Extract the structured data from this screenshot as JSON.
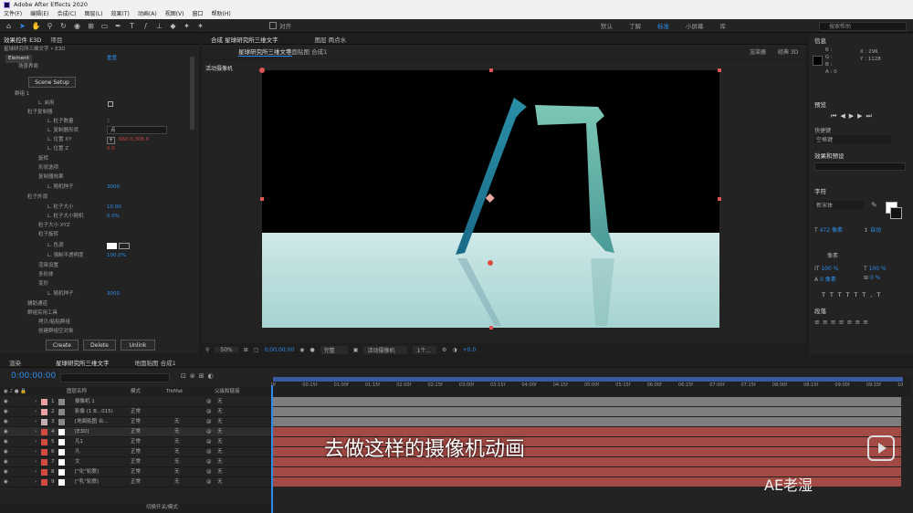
{
  "titlebar": {
    "title": "Adobe After Effects 2020"
  },
  "menu": [
    "文件(F)",
    "编辑(E)",
    "合成(C)",
    "图层(L)",
    "效果(T)",
    "动画(A)",
    "视图(V)",
    "窗口",
    "帮助(H)"
  ],
  "toolbar": {
    "align_label": "对齐",
    "workspaces": [
      "默认",
      "了解",
      "标准",
      "小屏幕",
      "库"
    ],
    "search_placeholder": "搜索帮助"
  },
  "effects_panel": {
    "tabs": [
      "效果控件 E3D",
      "项目"
    ],
    "layer_path": "星球研究所三维文字 • E3D",
    "effect_name": "Element",
    "reset": "重置",
    "scene_label": "场景界面",
    "scene_setup": "Scene Setup",
    "rows": [
      {
        "text": "群组 1"
      },
      {
        "text": "L. 启用"
      },
      {
        "text": "粒子复制器"
      },
      {
        "text": "L. 粒子数量",
        "value": "1"
      },
      {
        "text": "L. 复制器形状",
        "value": "点"
      },
      {
        "text": "L. 位置 XY",
        "value": "660.0,306.0"
      },
      {
        "text": "L. 位置 Z",
        "value": "0.0"
      },
      {
        "text": "旋转"
      },
      {
        "text": "形状选项"
      },
      {
        "text": "复制器效果"
      },
      {
        "text": "L. 随机种子",
        "value": "3000"
      },
      {
        "text": "粒子外观"
      },
      {
        "text": "L. 粒子大小",
        "value": "10.00"
      },
      {
        "text": "L. 粒子大小随机",
        "value": "0.0%"
      },
      {
        "text": "粒子大小 XYZ"
      },
      {
        "text": "粒子旋转"
      },
      {
        "text": "L. 色调"
      },
      {
        "text": "L. 强制不透明度",
        "value": "100.0%"
      },
      {
        "text": "渲染设置"
      },
      {
        "text": "多形体"
      },
      {
        "text": "变形"
      },
      {
        "text": "L. 随机种子",
        "value": "3000"
      },
      {
        "text": "辅助通道"
      },
      {
        "text": "群组实用工具"
      },
      {
        "text": "拷贝/粘贴群组"
      },
      {
        "text": "创建群组空对象"
      }
    ],
    "buttons": [
      "Create",
      "Delete",
      "Unlink"
    ]
  },
  "comp_panel": {
    "tabs": [
      "合成 星球研究所三维文字",
      "图层 两点水"
    ],
    "subtabs": [
      "星球研究所三维文字",
      "地面贴图 合成1"
    ],
    "renderer_label": "渲染器",
    "renderer_value": "经典 3D",
    "camera_label": "活动摄像机",
    "zoom": "50%",
    "timecode": "0;00;00;00",
    "quality": "完整",
    "camera_view": "活动摄像机",
    "views": "1个...",
    "exposure": "+0.0"
  },
  "right_panel": {
    "info_title": "信息",
    "info_values": [
      "R :",
      "G :",
      "B :",
      "A : 0"
    ],
    "coords": [
      "X : 296",
      "Y : 1128"
    ],
    "preview_title": "预览",
    "shortcut_label": "快捷键",
    "shortcut_value": "空格键",
    "effects_presets": "效果和预设",
    "char_title": "字符",
    "font": "新宋体",
    "font_size": "472 像素",
    "auto": "自动",
    "px_label": "像素",
    "scale1": "100 %",
    "scale2": "100 %",
    "baseline": "0 像素",
    "tsume": "0 %",
    "para_title": "段落"
  },
  "timeline": {
    "tabs": [
      "渲染",
      "星球研究所三维文字",
      "地面贴图 合成1"
    ],
    "timecode": "0:00:00:00",
    "col_headers": {
      "name": "图层名称",
      "mode": "模式",
      "trkmat": "TrkMat",
      "parent": "父级和链接"
    },
    "ruler": [
      "0f",
      "00:15f",
      "01:00f",
      "01:15f",
      "02:00f",
      "02:15f",
      "03:00f",
      "03:15f",
      "04:00f",
      "04:15f",
      "05:00f",
      "05:15f",
      "06:00f",
      "06:15f",
      "07:00f",
      "07:15f",
      "08:00f",
      "08:15f",
      "09:00f",
      "09:15f",
      "10"
    ],
    "layers": [
      {
        "num": "1",
        "name": "摄像机 1",
        "mode": "",
        "trk": "",
        "parent": "无",
        "color": "#e8a0a0"
      },
      {
        "num": "2",
        "name": "影像 (1 B...015)",
        "mode": "正常",
        "trk": "",
        "parent": "无",
        "color": "#e8a0a0"
      },
      {
        "num": "3",
        "name": "[地面贴图 合...",
        "mode": "正常",
        "trk": "无",
        "parent": "无",
        "color": "#c0b0b0"
      },
      {
        "num": "4",
        "name": "[E3D]",
        "mode": "正常",
        "trk": "无",
        "parent": "无",
        "color": "#d04a40"
      },
      {
        "num": "5",
        "name": "凡1",
        "mode": "正常",
        "trk": "无",
        "parent": "无",
        "color": "#d04a40"
      },
      {
        "num": "6",
        "name": "凡",
        "mode": "正常",
        "trk": "无",
        "parent": "无",
        "color": "#d04a40"
      },
      {
        "num": "7",
        "name": "文",
        "mode": "正常",
        "trk": "无",
        "parent": "无",
        "color": "#d04a40"
      },
      {
        "num": "8",
        "name": "[\"化\"轮廓]",
        "mode": "正常",
        "trk": "无",
        "parent": "无",
        "color": "#d04a40"
      },
      {
        "num": "9",
        "name": "[\"乳\"轮廓]",
        "mode": "正常",
        "trk": "无",
        "parent": "无",
        "color": "#d04a40"
      }
    ],
    "footer": "切换开关/模式"
  },
  "subtitle": "去做这样的摄像机动画",
  "watermark": "AE老湿"
}
